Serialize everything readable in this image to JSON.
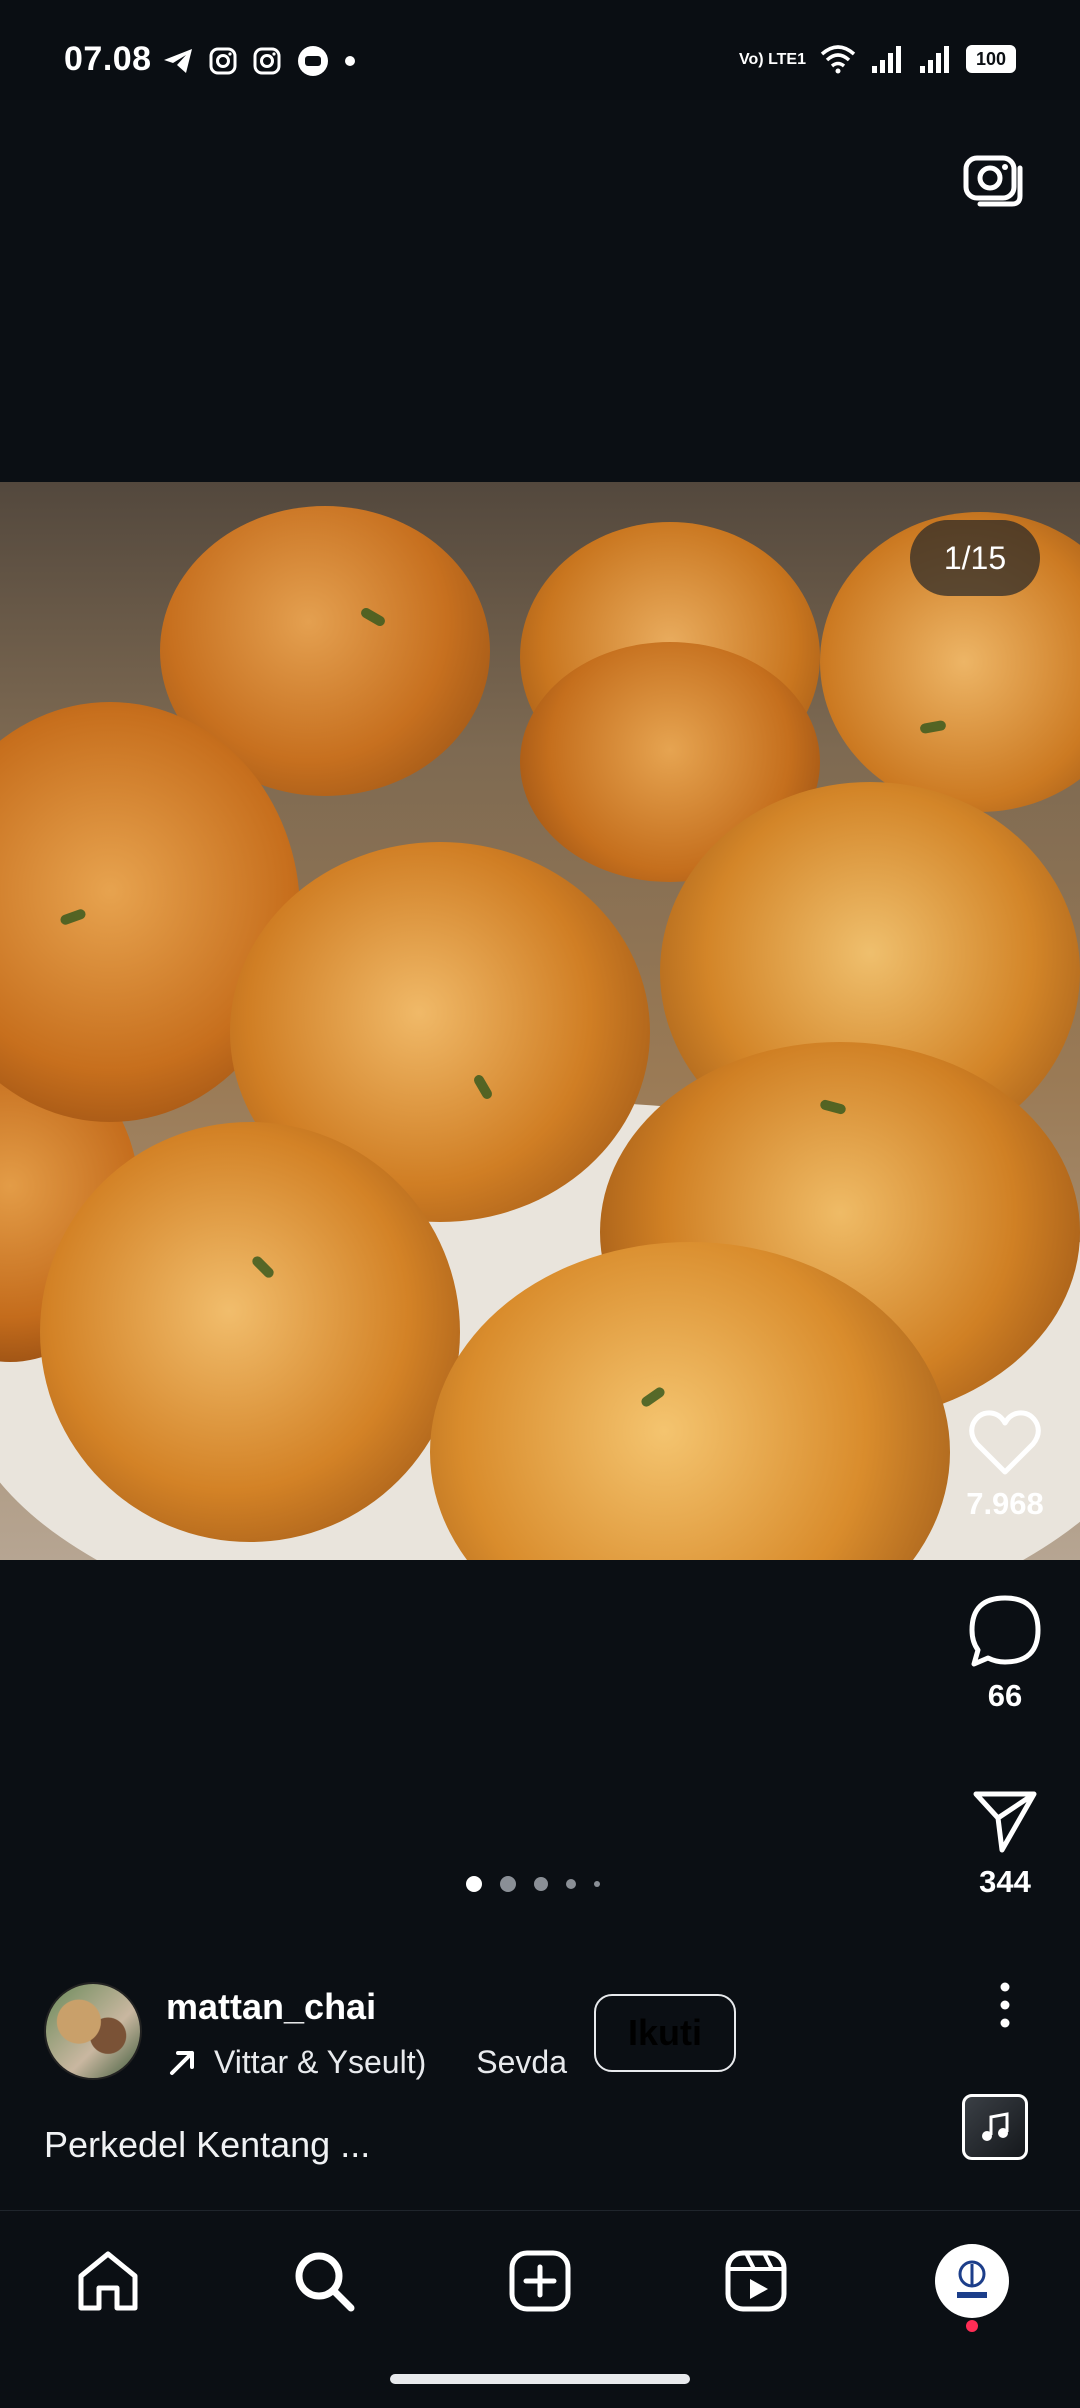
{
  "status_bar": {
    "time": "07.08",
    "network_label": "Vo) LTE1",
    "battery": "100",
    "left_icons": [
      "telegram-icon",
      "instagram-icon",
      "instagram-icon",
      "chat-icon",
      "dot-icon"
    ],
    "right_icons": [
      "wifi-icon",
      "signal-icon",
      "signal-icon",
      "battery-icon"
    ]
  },
  "post": {
    "media_counter": "1/15",
    "likes": "7.968",
    "comments": "66",
    "shares": "344",
    "carousel_dots": 5,
    "active_dot": 0
  },
  "author": {
    "username": "mattan_chai",
    "audio_artist": "Vittar & Yseult)",
    "audio_title": "Sevda",
    "follow_label": "Ikuti"
  },
  "caption": "Perkedel Kentang ...",
  "bottom_nav": {
    "items": [
      "home-icon",
      "search-icon",
      "create-icon",
      "reels-icon",
      "profile-avatar"
    ]
  },
  "colors": {
    "background": "#0b0f14",
    "text": "#ffffff",
    "notification": "#ff2d55"
  }
}
